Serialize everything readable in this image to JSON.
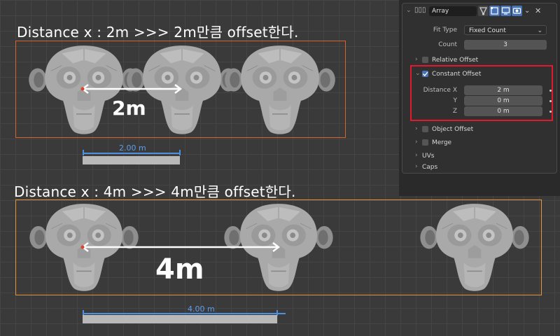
{
  "captions": {
    "top": "Distance x : 2m  >>> 2m만큼 offset한다.",
    "bottom": "Distance x : 4m  >>> 4m만큼 offset한다."
  },
  "annotations": {
    "top_hand": "2m",
    "bottom_hand": "4m"
  },
  "measurements": {
    "top_label": "2.00 m",
    "bottom_label": "4.00 m"
  },
  "colors": {
    "top_outline": "#d9622b",
    "bottom_outline": "#e8953a",
    "measure_blue": "#4d8fe0",
    "highlight_red": "#e0192d"
  },
  "panel": {
    "modifier_name": "Array",
    "fit_type_label": "Fit Type",
    "fit_type_value": "Fixed Count",
    "count_label": "Count",
    "count_value": "3",
    "relative_offset": "Relative Offset",
    "constant_offset": "Constant Offset",
    "distance_x_label": "Distance X",
    "distance_x_value": "2 m",
    "y_label": "Y",
    "y_value": "0 m",
    "z_label": "Z",
    "z_value": "0 m",
    "object_offset": "Object Offset",
    "merge": "Merge",
    "uvs": "UVs",
    "caps": "Caps",
    "icons": [
      "modifier-array-icon",
      "vertex-icon",
      "editmode-icon",
      "viewport-icon",
      "render-icon",
      "chevron-down-icon",
      "close-icon"
    ]
  }
}
